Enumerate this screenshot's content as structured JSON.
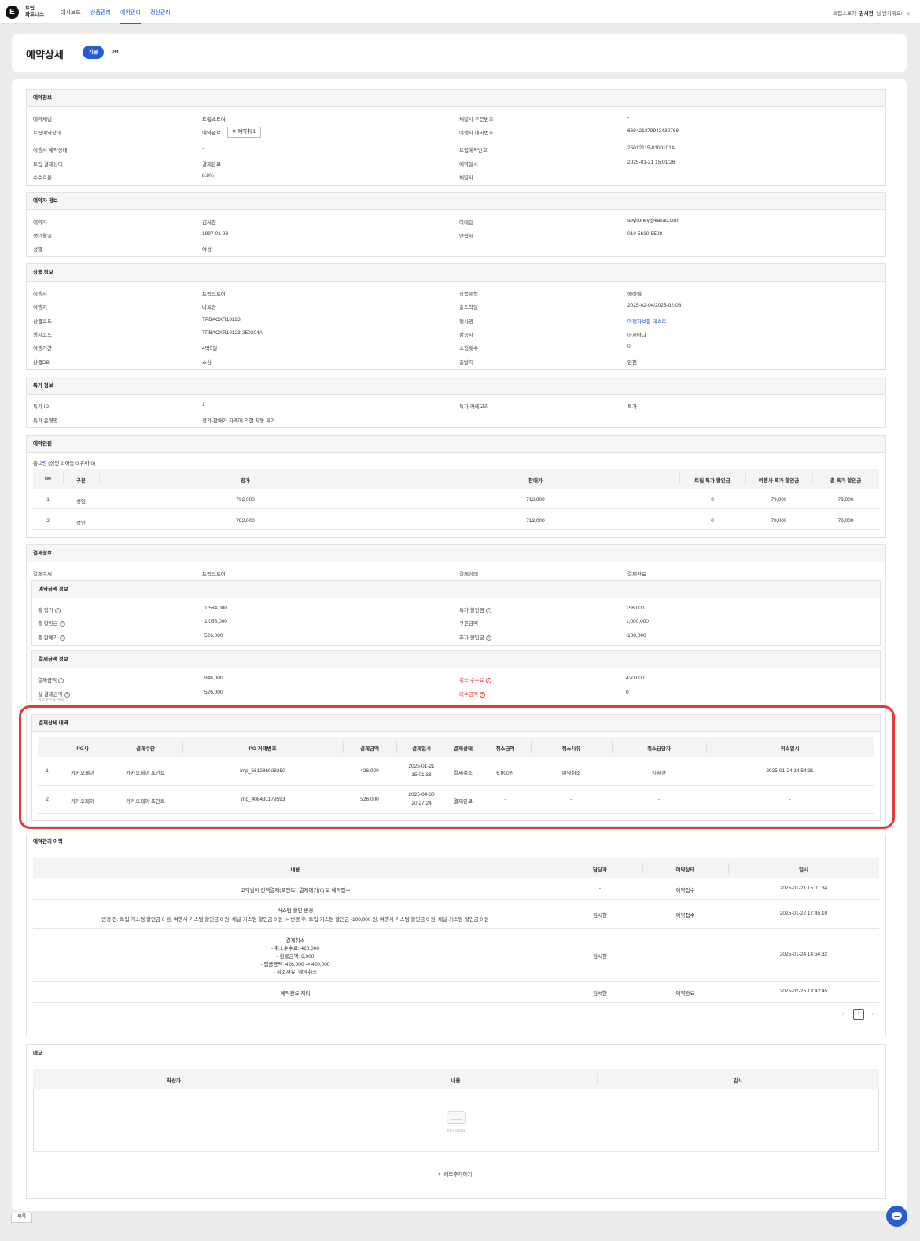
{
  "nav": {
    "logo_letter": "E",
    "logo_line1": "트립",
    "logo_line2": "파트너스",
    "links": [
      "대시보드",
      "상품관리",
      "예약관리",
      "정산관리"
    ],
    "store": "트립스토어",
    "user_name": "김서현",
    "greeting": "님 반가워요!"
  },
  "header": {
    "title": "예약상세",
    "tabs": [
      "기본",
      "PB"
    ]
  },
  "reservation_info": {
    "title": "예약정보",
    "rows": [
      [
        "예약채널",
        "트립스토어",
        "채널사 주문번호",
        "-"
      ],
      [
        "트립예약상태",
        "예약완료",
        "여행사 예약번호",
        "669421379942432768"
      ],
      [
        "여행사 예약상태",
        "-",
        "트립예약번호",
        "25012115-0100101A"
      ],
      [
        "트립 결제상태",
        "결제완료",
        "예약일시",
        "2025-01-21 15:01:26"
      ],
      [
        "수수료율",
        "8.8%",
        "채널사",
        ""
      ]
    ],
    "cancel_button": "예약취소"
  },
  "booker_info": {
    "title": "예약자 정보",
    "rows": [
      [
        "예약자",
        "김서현",
        "이메일",
        "soyhoney@kakao.com"
      ],
      [
        "생년월일",
        "1997-01-23",
        "연락처",
        "010-5630-5508"
      ],
      [
        "성별",
        "여성",
        "",
        ""
      ]
    ]
  },
  "product_info": {
    "title": "상품 정보",
    "rows": [
      [
        "여행사",
        "트립스토어",
        "상품유형",
        "에어텔"
      ],
      [
        "여행지",
        "나트랑",
        "출도착일",
        "2025-02-04/2025-02-08"
      ],
      [
        "상품코드",
        "TPBACXR10123",
        "행사명",
        "여행자보험 테스트"
      ],
      [
        "행사코드",
        "TPBACXR10123-250204A",
        "항공사",
        "아시아나"
      ],
      [
        "여행기간",
        "4박5일",
        "쇼핑횟수",
        "0"
      ],
      [
        "상품DB",
        "소싱",
        "출발지",
        "인천"
      ]
    ]
  },
  "special_info": {
    "title": "특가 정보",
    "rows": [
      [
        "특가 ID",
        "1",
        "특가 카테고리",
        "특가"
      ],
      [
        "특가 운영명",
        "정가-판매가 차액에 의한 자동 특가",
        "",
        ""
      ]
    ]
  },
  "travelers": {
    "title": "예약인원",
    "summary_prefix": "총 ",
    "summary_count": "2명",
    "summary_rest": " (성인 2,아동 0,유아 0)",
    "columns": [
      "no",
      "구분",
      "정가",
      "판매가",
      "트립 특가 할인금",
      "여행사 특가 할인금",
      "총 특가 할인금"
    ],
    "rows": [
      [
        "1",
        "성인",
        "792,000",
        "713,000",
        "0",
        "79,000",
        "79,000"
      ],
      [
        "2",
        "성인",
        "792,000",
        "713,000",
        "0",
        "79,000",
        "79,000"
      ]
    ]
  },
  "payment": {
    "title": "결제정보",
    "top_row": [
      "결제주체",
      "트립스토어",
      "결제상태",
      "결제완료"
    ],
    "amount_title": "예약금액 정보",
    "amount_rows": [
      [
        "총 정가",
        "1,584,000",
        "특가 할인금",
        "158,000"
      ],
      [
        "총 할인금",
        "1,058,000",
        "쿠폰금액",
        "1,000,000"
      ],
      [
        "총 판매가",
        "526,000",
        "추가 할인금",
        "-100,000"
      ]
    ],
    "paid_title": "결제금액 정보",
    "paid_rows": [
      [
        "결제금액",
        "946,000",
        "취소 수수료",
        "420,000"
      ],
      [
        "실 결제금액",
        "526,000",
        "미수금액",
        "0"
      ]
    ],
    "paid_note": "취소수수료 제외",
    "detail_title": "결제상세 내역",
    "detail_columns": [
      "PG사",
      "결제수단",
      "PG 거래번호",
      "결제금액",
      "결제일시",
      "결제상태",
      "취소금액",
      "취소사유",
      "취소담당자",
      "취소일시"
    ],
    "detail_rows": [
      [
        "1",
        "카카오페이",
        "카카오페이 포인트",
        "imp_561286928250",
        "426,000",
        "2025-01-21",
        "15:01:33",
        "결제취소",
        "6,000원",
        "예약취소",
        "김서현",
        "2025-01-24 14:54:31"
      ],
      [
        "2",
        "카카오페이",
        "카카오페이 포인트",
        "imp_408431179593",
        "526,000",
        "2025-04-30",
        "20:27:24",
        "결제완료",
        "-",
        "-",
        "-",
        "-"
      ]
    ]
  },
  "history": {
    "title": "예약관리 이력",
    "columns": [
      "내용",
      "담당자",
      "예약상태",
      "일시"
    ],
    "rows": [
      {
        "lines": [
          "고객님이 전액결제(포인트) '결제대기(0)'로 예약접수"
        ],
        "manager": "-",
        "status": "예약접수",
        "date": "2025-01-21 15:01:34"
      },
      {
        "lines": [
          "커스텀 할인 변경",
          "변경 전: 트립 커스텀 할인금 0 원, 여행사 커스텀 할인금 0 원, 채널 커스텀 할인금 0 원 -> 변경 후: 트립 커스텀 할인금 -100,000 원, 여행사 커스텀 할인금 0 원, 채널 커스텀 할인금 0 원"
        ],
        "manager": "김서현",
        "status": "예약접수",
        "date": "2025-01-22 17:45:10"
      },
      {
        "lines": [
          "결제취소",
          "- 취소수수료: 420,000",
          "- 환불금액: 6,000",
          "- 입금금액: 426,000 -> 420,000",
          "- 취소사유: 예약취소"
        ],
        "manager": "김서현",
        "status": "",
        "date": "2025-01-24 14:54:32"
      },
      {
        "lines": [
          "예약완료 처리"
        ],
        "manager": "김서현",
        "status": "예약완료",
        "date": "2025-02-25 13:42:45"
      }
    ],
    "page": "1"
  },
  "memo": {
    "title": "메모",
    "columns": [
      "작성자",
      "내용",
      "일시"
    ],
    "empty": "No data",
    "add_label": "메모추가하기"
  },
  "footer": {
    "back_label": "목록"
  }
}
